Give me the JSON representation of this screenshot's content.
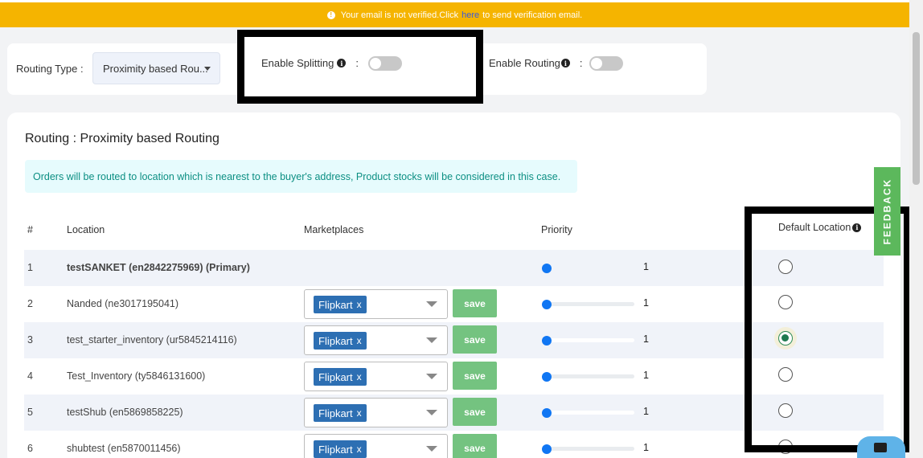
{
  "banner": {
    "text_before": "Your email is not verified.Click",
    "link_text": "here",
    "text_after": "to send verification email."
  },
  "routing_type": {
    "label": "Routing Type :",
    "selected": "Proximity based Rou..."
  },
  "enable_splitting": {
    "label": "Enable Splitting",
    "colon": ":",
    "enabled": false
  },
  "enable_routing": {
    "label": "Enable Routing",
    "colon": ":",
    "enabled": false
  },
  "card": {
    "title": "Routing : Proximity based Routing",
    "notice": "Orders will be routed to location which is nearest to the buyer's address, Product stocks will be considered in this case."
  },
  "table": {
    "headers": {
      "num": "#",
      "location": "Location",
      "marketplaces": "Marketplaces",
      "priority": "Priority",
      "default_location": "Default Location"
    },
    "rows": [
      {
        "num": "1",
        "location": "testSANKET (en2842275969) (Primary)",
        "marketplace": "",
        "priority": "1",
        "default": false
      },
      {
        "num": "2",
        "location": "Nanded (ne3017195041)",
        "marketplace": "Flipkart",
        "tag_x": "x",
        "save": "save",
        "priority": "1",
        "default": false
      },
      {
        "num": "3",
        "location": "test_starter_inventory (ur5845214116)",
        "marketplace": "Flipkart",
        "tag_x": "x",
        "save": "save",
        "priority": "1",
        "default": true
      },
      {
        "num": "4",
        "location": "Test_Inventory (ty5846131600)",
        "marketplace": "Flipkart",
        "tag_x": "x",
        "save": "save",
        "priority": "1",
        "default": false
      },
      {
        "num": "5",
        "location": "testShub (en5869858225)",
        "marketplace": "Flipkart",
        "tag_x": "x",
        "save": "save",
        "priority": "1",
        "default": false
      },
      {
        "num": "6",
        "location": "shubtest (en5870011456)",
        "marketplace": "Flipkart",
        "tag_x": "x",
        "save": "save",
        "priority": "1",
        "default": false
      }
    ]
  },
  "feedback": {
    "label": "FEEDBACK"
  },
  "icons": {
    "info": "info-icon",
    "caret": "chevron-down-icon",
    "chat": "chat-icon"
  },
  "colors": {
    "banner": "#f5b400",
    "tag": "#2d6fb3",
    "save": "#74c380",
    "slider": "#1076f3",
    "notice_text": "#0c8f83",
    "feedback": "#5cb85c"
  }
}
